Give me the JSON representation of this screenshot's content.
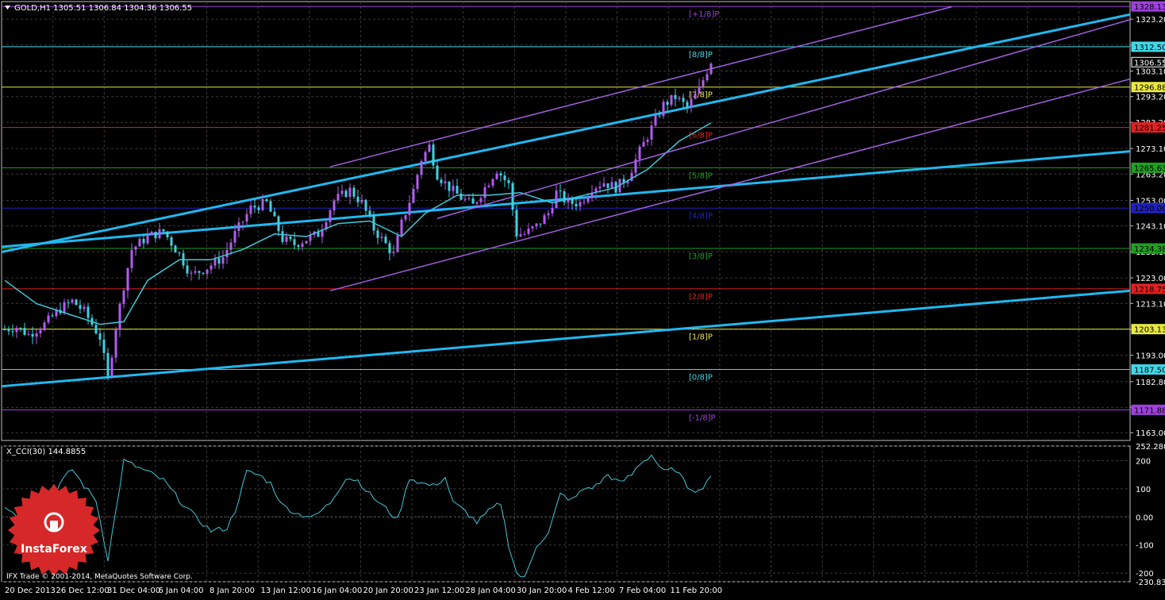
{
  "window": {
    "symbol_header": "GOLD,H1  1305.51 1306.84 1304.36 1306.55",
    "indicator_header": "X_CCI(30) 144.8855",
    "copyright": "IFX Trade © 2001-2014, MetaQuotes Software Corp.",
    "brand": "InstaForex"
  },
  "colors": {
    "background": "#000000",
    "grid": "#3a3a3a",
    "axis": "#c0c0c0",
    "bull": "#b25cf0",
    "bear": "#40d0e0",
    "ma": "#40c8d8",
    "channel": "#a060e0",
    "trend": "#20b8f0",
    "cci": "#40c8d8",
    "logo": "#d62828"
  },
  "chart_data": [
    {
      "type": "candlestick",
      "title": "GOLD,H1",
      "price_scale": {
        "ymin": 1160,
        "ymax": 1330
      },
      "y_ticks": [
        "1323.20",
        "1313.20",
        "1303.10",
        "1293.20",
        "1283.20",
        "1273.10",
        "1263.20",
        "1253.00",
        "1243.10",
        "1233.10",
        "1223.00",
        "1213.10",
        "1203.00",
        "1193.00",
        "1182.80",
        "1172.80",
        "1163.00"
      ],
      "x_labels": [
        "20 Dec 2013",
        "26 Dec 12:00",
        "31 Dec 04:00",
        "6 Jan 04:00",
        "8 Jan 20:00",
        "13 Jan 12:00",
        "16 Jan 04:00",
        "20 Jan 20:00",
        "23 Jan 12:00",
        "28 Jan 04:00",
        "30 Jan 20:00",
        "4 Feb 12:00",
        "7 Feb 04:00",
        "11 Feb 20:00"
      ],
      "close_path": [
        [
          0,
          1203
        ],
        [
          3,
          1204
        ],
        [
          6,
          1201
        ],
        [
          10,
          1205
        ],
        [
          14,
          1211
        ],
        [
          17,
          1214
        ],
        [
          20,
          1210
        ],
        [
          24,
          1200
        ],
        [
          26,
          1184
        ],
        [
          28,
          1204
        ],
        [
          30,
          1220
        ],
        [
          32,
          1234
        ],
        [
          36,
          1239
        ],
        [
          40,
          1241
        ],
        [
          44,
          1232
        ],
        [
          47,
          1224
        ],
        [
          51,
          1227
        ],
        [
          55,
          1231
        ],
        [
          58,
          1240
        ],
        [
          62,
          1250
        ],
        [
          66,
          1252
        ],
        [
          70,
          1238
        ],
        [
          73,
          1236
        ],
        [
          76,
          1238
        ],
        [
          79,
          1240
        ],
        [
          83,
          1253
        ],
        [
          87,
          1257
        ],
        [
          90,
          1252
        ],
        [
          93,
          1242
        ],
        [
          96,
          1236
        ],
        [
          98,
          1232
        ],
        [
          100,
          1244
        ],
        [
          103,
          1257
        ],
        [
          105,
          1269
        ],
        [
          107,
          1274
        ],
        [
          109,
          1263
        ],
        [
          112,
          1258
        ],
        [
          115,
          1254
        ],
        [
          118,
          1251
        ],
        [
          121,
          1258
        ],
        [
          124,
          1265
        ],
        [
          127,
          1259
        ],
        [
          129,
          1240
        ],
        [
          131,
          1240
        ],
        [
          134,
          1243
        ],
        [
          137,
          1248
        ],
        [
          139,
          1256
        ],
        [
          142,
          1252
        ],
        [
          145,
          1252
        ],
        [
          148,
          1258
        ],
        [
          151,
          1260
        ],
        [
          154,
          1258
        ],
        [
          157,
          1262
        ],
        [
          160,
          1272
        ],
        [
          163,
          1281
        ],
        [
          166,
          1290
        ],
        [
          169,
          1293
        ],
        [
          172,
          1289
        ],
        [
          175,
          1296
        ],
        [
          178,
          1307
        ]
      ],
      "bars_total": 178,
      "ma_path": [
        [
          0,
          1222
        ],
        [
          8,
          1213
        ],
        [
          16,
          1209
        ],
        [
          24,
          1205
        ],
        [
          30,
          1206
        ],
        [
          36,
          1222
        ],
        [
          44,
          1230
        ],
        [
          52,
          1230
        ],
        [
          60,
          1234
        ],
        [
          68,
          1240
        ],
        [
          76,
          1239
        ],
        [
          84,
          1244
        ],
        [
          92,
          1245
        ],
        [
          100,
          1239
        ],
        [
          106,
          1248
        ],
        [
          114,
          1255
        ],
        [
          122,
          1255
        ],
        [
          130,
          1256
        ],
        [
          138,
          1252
        ],
        [
          146,
          1255
        ],
        [
          154,
          1258
        ],
        [
          162,
          1265
        ],
        [
          170,
          1276
        ],
        [
          178,
          1283
        ]
      ],
      "murrey_levels": [
        {
          "label": "[+1/8]P",
          "price": 1328.13,
          "color": "#a040e0"
        },
        {
          "label": "[8/8]P",
          "price": 1312.5,
          "color": "#40d8e8"
        },
        {
          "label": "[7/8]P",
          "price": 1296.88,
          "color": "#e8e840"
        },
        {
          "label": "[6/8]P",
          "price": 1281.25,
          "color": "#e02020"
        },
        {
          "label": "[5/8]P",
          "price": 1265.63,
          "color": "#20a020"
        },
        {
          "label": "[4/8]P",
          "price": 1250.0,
          "color": "#2020c0"
        },
        {
          "label": "[3/8]P",
          "price": 1234.38,
          "color": "#20a020"
        },
        {
          "label": "[2/8]P",
          "price": 1218.75,
          "color": "#e02020"
        },
        {
          "label": "[1/8]P",
          "price": 1203.13,
          "color": "#e8e840"
        },
        {
          "label": "[0/8]P",
          "price": 1187.5,
          "color": "#40d8e8"
        },
        {
          "label": "[-1/8]P",
          "price": 1171.88,
          "color": "#a040e0"
        }
      ],
      "price_tags": [
        {
          "text": "1328.13",
          "price": 1328.13,
          "bg": "#a040e0",
          "fg": "#000000"
        },
        {
          "text": "1312.50",
          "price": 1312.5,
          "bg": "#40d8e8",
          "fg": "#000000"
        },
        {
          "text": "1306.55",
          "price": 1306.55,
          "bg": "#000000",
          "fg": "#ffffff"
        },
        {
          "text": "1296.88",
          "price": 1296.88,
          "bg": "#e8e840",
          "fg": "#000000"
        },
        {
          "text": "1281.25",
          "price": 1281.25,
          "bg": "#e02020",
          "fg": "#000000"
        },
        {
          "text": "1265.63",
          "price": 1265.63,
          "bg": "#20a020",
          "fg": "#000000"
        },
        {
          "text": "1250.00",
          "price": 1250.0,
          "bg": "#2020c0",
          "fg": "#000000"
        },
        {
          "text": "1234.38",
          "price": 1234.38,
          "bg": "#20a020",
          "fg": "#000000"
        },
        {
          "text": "1218.75",
          "price": 1218.75,
          "bg": "#e02020",
          "fg": "#000000"
        },
        {
          "text": "1203.13",
          "price": 1203.13,
          "bg": "#e8e840",
          "fg": "#000000"
        },
        {
          "text": "1187.50",
          "price": 1187.5,
          "bg": "#40d8e8",
          "fg": "#000000"
        },
        {
          "text": "1171.88",
          "price": 1171.88,
          "bg": "#a040e0",
          "fg": "#000000"
        }
      ],
      "trendlines": [
        {
          "from": [
            0,
            1233
          ],
          "to": [
            285,
            1325
          ]
        },
        {
          "from": [
            0,
            1181
          ],
          "to": [
            285,
            1218
          ]
        },
        {
          "from": [
            0,
            1235
          ],
          "to": [
            285,
            1272
          ]
        }
      ],
      "channel_lines": [
        {
          "from": [
            83,
            1266
          ],
          "to": [
            240,
            1328
          ]
        },
        {
          "from": [
            83,
            1218
          ],
          "to": [
            285,
            1300
          ]
        },
        {
          "from": [
            110,
            1246
          ],
          "to": [
            285,
            1323
          ]
        }
      ]
    },
    {
      "type": "line",
      "title": "X_CCI(30) 144.8855",
      "range": [
        -230.8365,
        252.2806
      ],
      "y_ticks": [
        {
          "text": "252.2806",
          "value": 252.2806
        },
        {
          "text": "200",
          "value": 200
        },
        {
          "text": "100",
          "value": 100
        },
        {
          "text": "0.00",
          "value": 0
        },
        {
          "text": "-100",
          "value": -100
        },
        {
          "text": "-200",
          "value": -200
        },
        {
          "text": "-230.8365",
          "value": -230.8365
        }
      ],
      "values_path": [
        [
          0,
          40
        ],
        [
          3,
          5
        ],
        [
          6,
          -20
        ],
        [
          10,
          20
        ],
        [
          14,
          120
        ],
        [
          17,
          170
        ],
        [
          20,
          110
        ],
        [
          23,
          60
        ],
        [
          26,
          -150
        ],
        [
          28,
          20
        ],
        [
          30,
          200
        ],
        [
          33,
          180
        ],
        [
          36,
          160
        ],
        [
          40,
          130
        ],
        [
          44,
          60
        ],
        [
          48,
          0
        ],
        [
          52,
          -50
        ],
        [
          56,
          -40
        ],
        [
          58,
          20
        ],
        [
          61,
          160
        ],
        [
          64,
          150
        ],
        [
          67,
          120
        ],
        [
          70,
          40
        ],
        [
          74,
          10
        ],
        [
          78,
          0
        ],
        [
          82,
          50
        ],
        [
          86,
          140
        ],
        [
          89,
          130
        ],
        [
          92,
          80
        ],
        [
          96,
          30
        ],
        [
          99,
          -10
        ],
        [
          102,
          140
        ],
        [
          105,
          120
        ],
        [
          108,
          110
        ],
        [
          111,
          140
        ],
        [
          113,
          50
        ],
        [
          116,
          20
        ],
        [
          119,
          -20
        ],
        [
          122,
          20
        ],
        [
          125,
          50
        ],
        [
          127,
          -100
        ],
        [
          129,
          -200
        ],
        [
          131,
          -220
        ],
        [
          134,
          -100
        ],
        [
          137,
          -60
        ],
        [
          140,
          80
        ],
        [
          143,
          60
        ],
        [
          146,
          100
        ],
        [
          149,
          110
        ],
        [
          152,
          150
        ],
        [
          155,
          120
        ],
        [
          158,
          150
        ],
        [
          160,
          190
        ],
        [
          163,
          220
        ],
        [
          166,
          160
        ],
        [
          169,
          170
        ],
        [
          172,
          110
        ],
        [
          175,
          90
        ],
        [
          178,
          150
        ]
      ]
    }
  ]
}
